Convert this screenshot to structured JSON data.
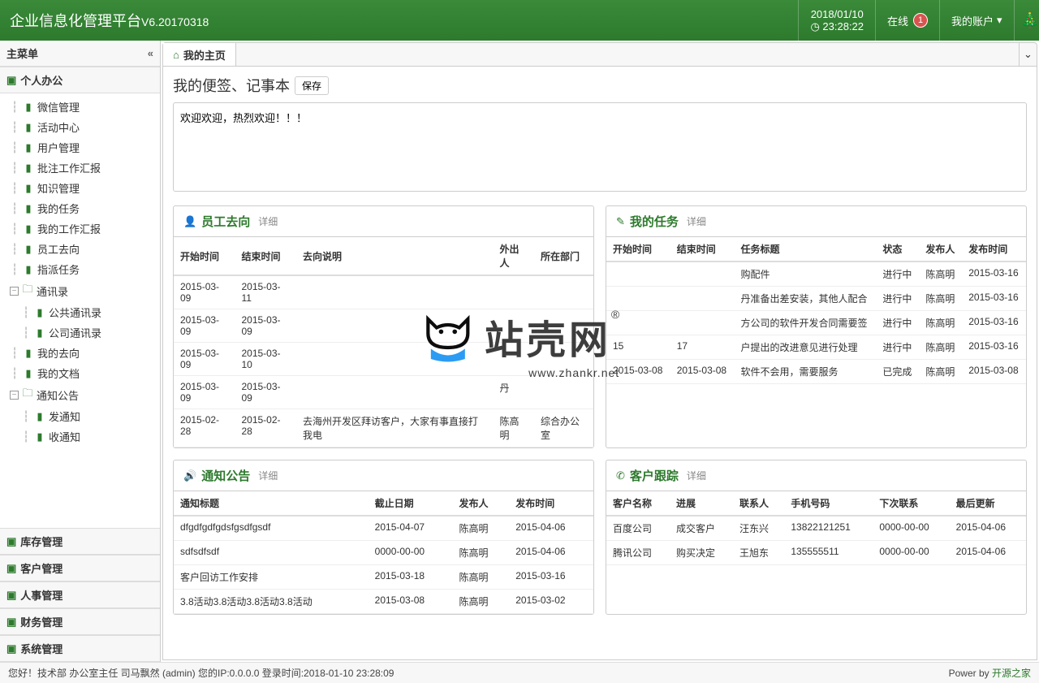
{
  "header": {
    "title_main": "企业信息化管理平台",
    "title_ver": "V6.20170318",
    "date": "2018/01/10",
    "time": "23:28:22",
    "online_label": "在线",
    "online_count": "1",
    "account_label": "我的账户"
  },
  "sidebar": {
    "main_menu": "主菜单",
    "personal": "个人办公",
    "tree": [
      "微信管理",
      "活动中心",
      "用户管理",
      "批注工作汇报",
      "知识管理",
      "我的任务",
      "我的工作汇报",
      "员工去向",
      "指派任务"
    ],
    "contacts": "通讯录",
    "contacts_children": [
      "公共通讯录",
      "公司通讯录"
    ],
    "after_contacts": [
      "我的去向",
      "我的文档"
    ],
    "notice": "通知公告",
    "notice_children": [
      "发通知",
      "收通知"
    ],
    "sections": [
      "库存管理",
      "客户管理",
      "人事管理",
      "财务管理",
      "系统管理"
    ]
  },
  "tabs": {
    "home": "我的主页"
  },
  "notes": {
    "title": "我的便签、记事本",
    "save": "保存",
    "content": "欢迎欢迎，热烈欢迎！！！"
  },
  "panel_staff": {
    "title": "员工去向",
    "detail": "详细",
    "headers": [
      "开始时间",
      "结束时间",
      "去向说明",
      "外出人",
      "所在部门"
    ],
    "rows": [
      [
        "2015-03-09",
        "2015-03-11",
        "",
        "",
        ""
      ],
      [
        "2015-03-09",
        "2015-03-09",
        "",
        "",
        ""
      ],
      [
        "2015-03-09",
        "2015-03-10",
        "",
        "",
        ""
      ],
      [
        "2015-03-09",
        "2015-03-09",
        "",
        "丹",
        ""
      ],
      [
        "2015-02-28",
        "2015-02-28",
        "去海州开发区拜访客户，大家有事直接打我电",
        "陈高明",
        "综合办公室"
      ]
    ]
  },
  "panel_tasks": {
    "title": "我的任务",
    "detail": "详细",
    "headers": [
      "开始时间",
      "结束时间",
      "任务标题",
      "状态",
      "发布人",
      "发布时间"
    ],
    "rows": [
      [
        "",
        "",
        "购配件",
        "进行中",
        "陈高明",
        "2015-03-16"
      ],
      [
        "",
        "",
        "丹准备出差安装，其他人配合",
        "进行中",
        "陈高明",
        "2015-03-16"
      ],
      [
        "",
        "",
        "方公司的软件开发合同需要签",
        "进行中",
        "陈高明",
        "2015-03-16"
      ],
      [
        "15",
        "17",
        "户提出的改进意见进行处理",
        "进行中",
        "陈高明",
        "2015-03-16"
      ],
      [
        "2015-03-08",
        "2015-03-08",
        "软件不会用，需要服务",
        "已完成",
        "陈高明",
        "2015-03-08"
      ]
    ]
  },
  "panel_notice": {
    "title": "通知公告",
    "detail": "详细",
    "headers": [
      "通知标题",
      "截止日期",
      "发布人",
      "发布时间"
    ],
    "rows": [
      [
        "dfgdfgdfgdsfgsdfgsdf",
        "2015-04-07",
        "陈高明",
        "2015-04-06"
      ],
      [
        "sdfsdfsdf",
        "0000-00-00",
        "陈高明",
        "2015-04-06"
      ],
      [
        "客户回访工作安排",
        "2015-03-18",
        "陈高明",
        "2015-03-16"
      ],
      [
        "3.8活动3.8活动3.8活动3.8活动",
        "2015-03-08",
        "陈高明",
        "2015-03-02"
      ]
    ]
  },
  "panel_customer": {
    "title": "客户跟踪",
    "detail": "详细",
    "headers": [
      "客户名称",
      "进展",
      "联系人",
      "手机号码",
      "下次联系",
      "最后更新"
    ],
    "rows": [
      [
        "百度公司",
        "成交客户",
        "汪东兴",
        "13822121251",
        "0000-00-00",
        "2015-04-06"
      ],
      [
        "腾讯公司",
        "购买决定",
        "王旭东",
        "135555511",
        "0000-00-00",
        "2015-04-06"
      ]
    ]
  },
  "watermark": {
    "text": "站壳网",
    "url": "www.zhankr.net"
  },
  "footer": {
    "left": "您好！技术部 办公室主任 司马飘然 (admin) 您的IP:0.0.0.0 登录时间:2018-01-10 23:28:09",
    "right_prefix": "Power by ",
    "right_link": "开源之家"
  }
}
